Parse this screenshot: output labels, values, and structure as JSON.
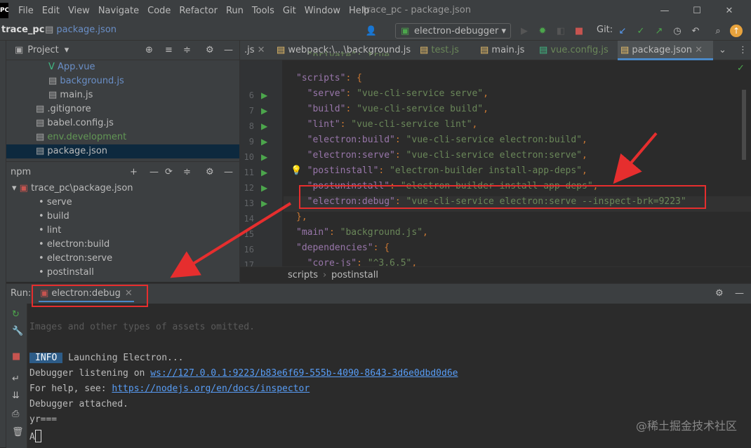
{
  "window": {
    "title": "trace_pc - package.json",
    "logo": "PC"
  },
  "menu": [
    "File",
    "Edit",
    "View",
    "Navigate",
    "Code",
    "Refactor",
    "Run",
    "Tools",
    "Git",
    "Window",
    "Help"
  ],
  "toolbar": {
    "project": "trace_pc",
    "file": "package.json",
    "run_config": "electron-debugger",
    "git_label": "Git:"
  },
  "project_panel": {
    "title": "Project",
    "files": [
      {
        "name": "App.vue",
        "color": "#6a8fc7"
      },
      {
        "name": "background.js",
        "color": "#6a8fc7"
      },
      {
        "name": "main.js",
        "color": "#bbbbbb"
      },
      {
        "name": ".gitignore",
        "color": "#bbbbbb"
      },
      {
        "name": "babel.config.js",
        "color": "#bbbbbb"
      },
      {
        "name": "env.development",
        "color": "#629755"
      },
      {
        "name": "package.json",
        "color": "#bbbbbb"
      }
    ]
  },
  "npm_panel": {
    "title": "npm",
    "root": "trace_pc\\package.json",
    "scripts": [
      "serve",
      "build",
      "lint",
      "electron:build",
      "electron:serve",
      "postinstall"
    ]
  },
  "tabs": [
    {
      "label": ".js",
      "active": false
    },
    {
      "label": "webpack:\\...\\background.js",
      "active": false
    },
    {
      "label": "test.js",
      "active": false
    },
    {
      "label": "main.js",
      "active": false
    },
    {
      "label": "vue.config.js",
      "active": false
    },
    {
      "label": "package.json",
      "active": true
    }
  ],
  "code": [
    {
      "n": "",
      "parts": [
        [
          "s",
          "  \"private\": true,"
        ]
      ]
    },
    {
      "n": "",
      "parts": [
        [
          "k",
          "\"scripts\""
        ],
        [
          "p",
          ": {"
        ]
      ]
    },
    {
      "n": "6",
      "parts": [
        [
          "k",
          "  \"serve\""
        ],
        [
          "p",
          ": "
        ],
        [
          "s",
          "\"vue-cli-service serve\""
        ],
        [
          "p",
          ","
        ]
      ]
    },
    {
      "n": "7",
      "parts": [
        [
          "k",
          "  \"build\""
        ],
        [
          "p",
          ": "
        ],
        [
          "s",
          "\"vue-cli-service build\""
        ],
        [
          "p",
          ","
        ]
      ]
    },
    {
      "n": "8",
      "parts": [
        [
          "k",
          "  \"lint\""
        ],
        [
          "p",
          ": "
        ],
        [
          "s",
          "\"vue-cli-service lint\""
        ],
        [
          "p",
          ","
        ]
      ]
    },
    {
      "n": "9",
      "parts": [
        [
          "k",
          "  \"electron:build\""
        ],
        [
          "p",
          ": "
        ],
        [
          "s",
          "\"vue-cli-service electron:build\""
        ],
        [
          "p",
          ","
        ]
      ]
    },
    {
      "n": "10",
      "parts": [
        [
          "k",
          "  \"electron:serve\""
        ],
        [
          "p",
          ": "
        ],
        [
          "s",
          "\"vue-cli-service electron:serve\""
        ],
        [
          "p",
          ","
        ]
      ]
    },
    {
      "n": "11",
      "parts": [
        [
          "k",
          "  \"postinstall\""
        ],
        [
          "p",
          ": "
        ],
        [
          "s",
          "\"electron-builder install-app-deps\""
        ],
        [
          "p",
          ","
        ]
      ]
    },
    {
      "n": "12",
      "parts": [
        [
          "k",
          "  \"postuninstall\""
        ],
        [
          "p",
          ": "
        ],
        [
          "s",
          "\"electron-builder install-app-deps\""
        ],
        [
          "p",
          ","
        ]
      ]
    },
    {
      "n": "13",
      "parts": [
        [
          "k",
          "  \"electron:debug\""
        ],
        [
          "p",
          ": "
        ],
        [
          "s",
          "\"vue-cli-service electron:serve --inspect-brk=9223\""
        ]
      ]
    },
    {
      "n": "14",
      "parts": [
        [
          "p",
          "},"
        ]
      ]
    },
    {
      "n": "15",
      "parts": [
        [
          "k",
          "\"main\""
        ],
        [
          "p",
          ": "
        ],
        [
          "s",
          "\"background.js\""
        ],
        [
          "p",
          ","
        ]
      ]
    },
    {
      "n": "16",
      "parts": [
        [
          "k",
          "\"dependencies\""
        ],
        [
          "p",
          ": {"
        ]
      ]
    },
    {
      "n": "17",
      "parts": [
        [
          "k",
          "  \"core-js\""
        ],
        [
          "p",
          ": "
        ],
        [
          "s",
          "\"^3.6.5\""
        ],
        [
          "p",
          ","
        ]
      ]
    }
  ],
  "editor_breadcrumb": [
    "scripts",
    "postinstall"
  ],
  "run": {
    "label": "Run:",
    "tab": "electron:debug",
    "lines": {
      "omitted": "Images and other types of assets omitted.",
      "info_badge": "INFO",
      "launching": " Launching Electron...",
      "listening_prefix": "Debugger listening on ",
      "listening_url": "ws://127.0.0.1:9223/b83e6f69-555b-4090-8643-3d6e0dbd0d6e",
      "help_prefix": "For help, see: ",
      "help_url": "https://nodejs.org/en/docs/inspector",
      "attached": "Debugger attached.",
      "yr": "yr===",
      "a": "A"
    }
  },
  "watermark": "@稀土掘金技术社区"
}
